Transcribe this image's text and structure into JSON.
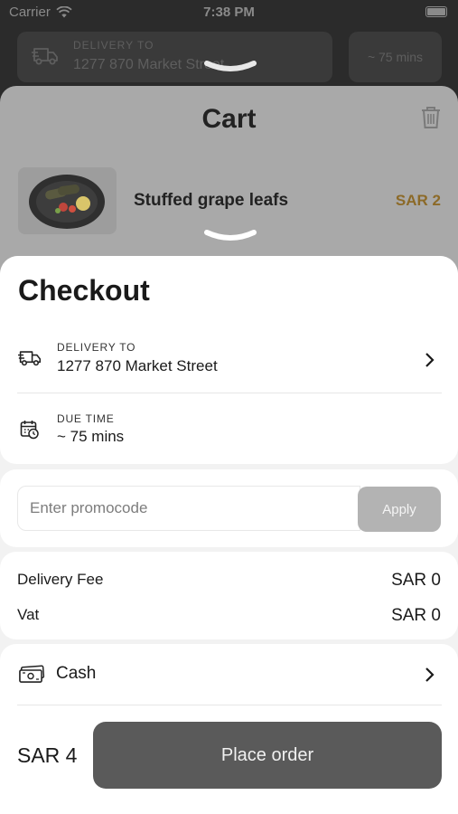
{
  "status_bar": {
    "carrier": "Carrier",
    "time": "7:38 PM"
  },
  "background": {
    "delivery_label": "DELIVERY TO",
    "delivery_address": "1277 870 Market Street",
    "time_chip": "~ 75 mins"
  },
  "cart": {
    "title": "Cart",
    "item": {
      "name": "Stuffed grape leafs",
      "price": "SAR 2"
    }
  },
  "checkout": {
    "title": "Checkout",
    "delivery": {
      "label": "DELIVERY TO",
      "value": "1277 870 Market Street"
    },
    "due_time": {
      "label": "DUE TIME",
      "value": "~ 75 mins"
    },
    "promo": {
      "placeholder": "Enter promocode",
      "apply_label": "Apply"
    },
    "fees": [
      {
        "name": "Delivery Fee",
        "amount": "SAR 0"
      },
      {
        "name": "Vat",
        "amount": "SAR 0"
      }
    ],
    "payment": {
      "method": "Cash"
    },
    "total": "SAR 4",
    "place_order_label": "Place order"
  },
  "colors": {
    "price_accent": "#8c6a28",
    "place_order_bg": "#5a5a5a",
    "apply_bg": "#b3b3b3"
  },
  "icons": [
    "wifi-icon",
    "battery-icon",
    "truck-icon",
    "trash-icon",
    "calendar-clock-icon",
    "chevron-right-icon",
    "cash-icon",
    "handle-chevron-icon"
  ]
}
